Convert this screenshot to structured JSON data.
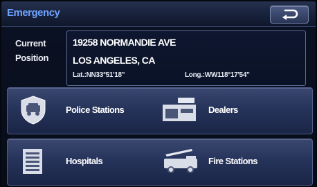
{
  "header": {
    "title": "Emergency"
  },
  "position": {
    "label_line1": "Current",
    "label_line2": "Position",
    "street": "19258 NORMANDIE AVE",
    "city": "LOS ANGELES, CA",
    "latitude": "Lat.:NN33°51'18\"",
    "longitude": "Long.:WW118°17'54\""
  },
  "categories": [
    {
      "label": "Police Stations",
      "icon": "police-badge-icon"
    },
    {
      "label": "Dealers",
      "icon": "dealer-icon"
    },
    {
      "label": "Hospitals",
      "icon": "hospital-icon"
    },
    {
      "label": "Fire Stations",
      "icon": "fire-truck-icon"
    }
  ],
  "colors": {
    "title": "#6fa2ff",
    "button": "#26335a"
  }
}
